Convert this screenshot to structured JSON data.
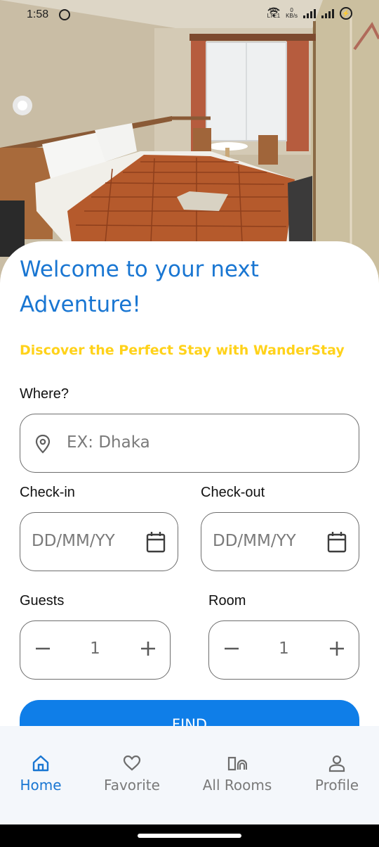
{
  "status_bar": {
    "time": "1:58",
    "net_top": "Vo)",
    "net_bottom": "LTE1",
    "speed_top": "0",
    "speed_bottom": "KB/s"
  },
  "hero": {
    "image": "hotel room with bed, windows and chairs"
  },
  "welcome": {
    "line1": "Welcome to your next",
    "line2": "Adventure!",
    "tagline": "Discover the Perfect Stay with WanderStay"
  },
  "form": {
    "where_label": "Where?",
    "where_placeholder": "EX: Dhaka",
    "checkin_label": "Check-in",
    "checkin_placeholder": "DD/MM/YY",
    "checkout_label": "Check-out",
    "checkout_placeholder": "DD/MM/YY",
    "guests_label": "Guests",
    "guests_value": "1",
    "room_label": "Room",
    "room_value": "1",
    "find_label": "FIND"
  },
  "nav": {
    "items": [
      {
        "label": "Home",
        "icon": "home-icon",
        "active": true
      },
      {
        "label": "Favorite",
        "icon": "heart-icon",
        "active": false
      },
      {
        "label": "All Rooms",
        "icon": "rooms-icon",
        "active": false
      },
      {
        "label": "Profile",
        "icon": "person-icon",
        "active": false
      }
    ]
  },
  "colors": {
    "primary": "#1976d2",
    "button": "#0f7ee8",
    "tagline": "#ffd21a",
    "nav_bg": "#f4f7fb"
  }
}
